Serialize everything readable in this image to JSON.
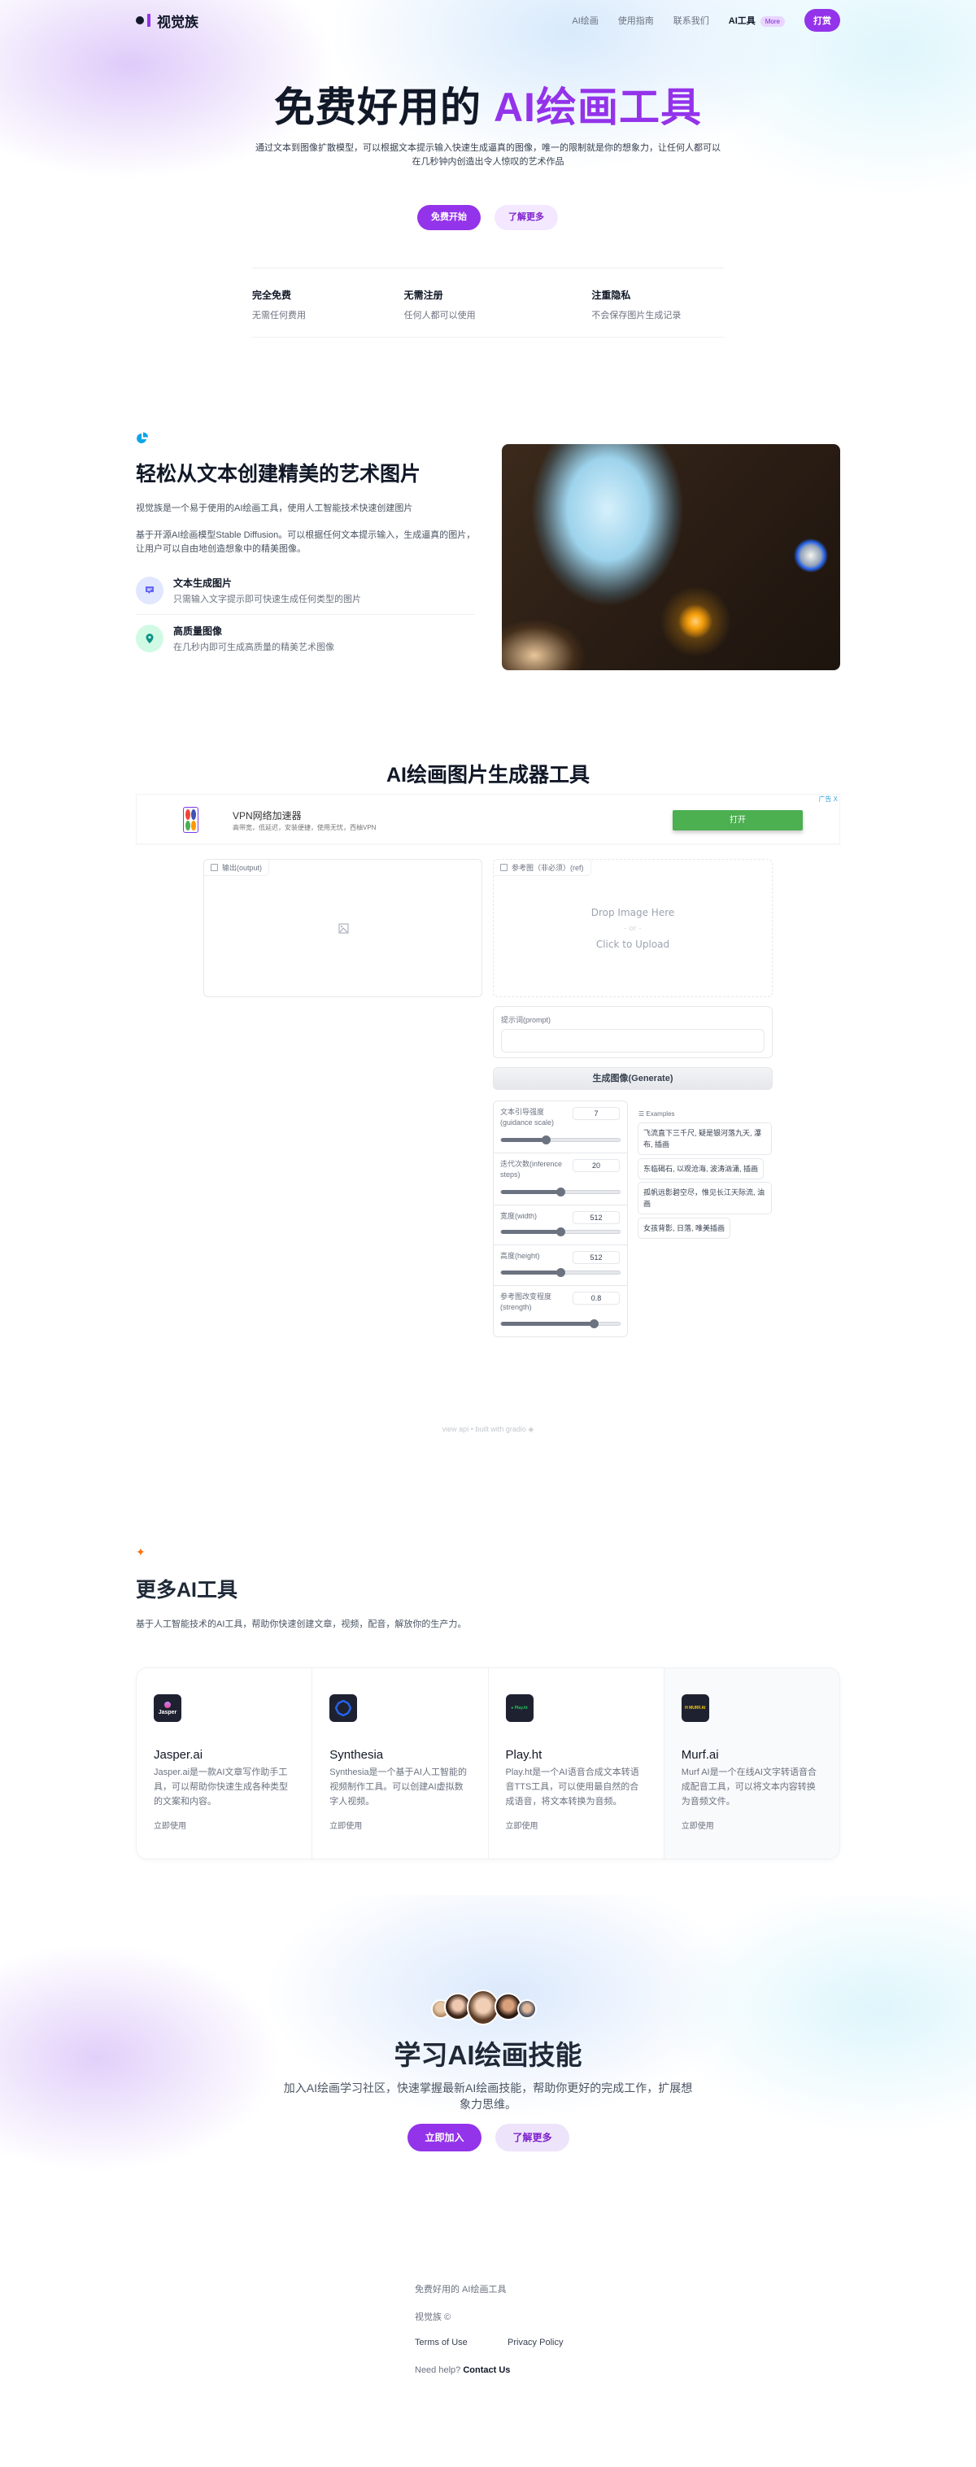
{
  "nav": {
    "brand": "视觉族",
    "links": [
      "AI绘画",
      "使用指南",
      "联系我们"
    ],
    "active_link": "AI工具",
    "more_badge": "More",
    "donate_label": "打赏"
  },
  "hero": {
    "title_plain": "免费好用的 ",
    "title_accent": "AI绘画工具",
    "subtitle": "通过文本到图像扩散模型，可以根据文本提示输入快速生成逼真的图像，唯一的限制就是你的想象力，让任何人都可以在几秒钟内创造出令人惊叹的艺术作品",
    "primary_button": "免费开始",
    "secondary_button": "了解更多",
    "features": [
      {
        "title": "完全免费",
        "desc": "无需任何费用"
      },
      {
        "title": "无需注册",
        "desc": "任何人都可以使用"
      },
      {
        "title": "注重隐私",
        "desc": "不会保存图片生成记录"
      }
    ]
  },
  "intro": {
    "title": "轻松从文本创建精美的艺术图片",
    "p1": "视觉族是一个易于使用的AI绘画工具，使用人工智能技术快速创建图片",
    "p2": "基于开源AI绘画模型Stable Diffusion。可以根据任何文本提示输入，生成逼真的图片，让用户可以自由地创造想象中的精美图像。",
    "items": [
      {
        "title": "文本生成图片",
        "desc": "只需输入文字提示即可快速生成任何类型的图片",
        "icon": "chat-icon"
      },
      {
        "title": "高质量图像",
        "desc": "在几秒内即可生成高质量的精美艺术图像",
        "icon": "location-pin-icon"
      }
    ]
  },
  "generator": {
    "title": "AI绘画图片生成器工具",
    "ad": {
      "title": "VPN网络加速器",
      "subtitle": "高带宽，低延迟，安装便捷，使用无忧，西柚VPN",
      "button": "打开",
      "label": "广告 X"
    },
    "output_label": "输出(output)",
    "ref_label": "参考图（非必须）(ref)",
    "upload_drop": "Drop Image Here",
    "upload_or": "- or -",
    "upload_click": "Click to Upload",
    "prompt_label": "提示词(prompt)",
    "prompt_value": "",
    "generate_button": "生成图像(Generate)",
    "sliders": [
      {
        "label": "文本引导强度(guidance scale)",
        "value": "7",
        "fraction": 0.38
      },
      {
        "label": "迭代次数(inference steps)",
        "value": "20",
        "fraction": 0.5
      },
      {
        "label": "宽度(width)",
        "value": "512",
        "fraction": 0.5
      },
      {
        "label": "高度(height)",
        "value": "512",
        "fraction": 0.5
      },
      {
        "label": "参考图改变程度(strength)",
        "value": "0.8",
        "fraction": 0.78
      }
    ],
    "examples_header": "☰ Examples",
    "examples": [
      "飞流直下三千尺, 疑是银河落九天, 瀑布, 插画",
      "东临碣石, 以观沧海, 波涛汹涌, 插画",
      "孤帆远影碧空尽，惟见长江天际流, 油画",
      "女孩背影, 日落, 唯美插画"
    ],
    "footer": "view api • built with gradio"
  },
  "tools": {
    "title": "更多AI工具",
    "subtitle": "基于人工智能技术的AI工具，帮助你快速创建文章，视频，配音，解放你的生产力。",
    "items": [
      {
        "name": "Jasper.ai",
        "icon_text": "Jasper",
        "desc": "Jasper.ai是一款AI文章写作助手工具，可以帮助你快速生成各种类型的文案和内容。",
        "link": "立即使用"
      },
      {
        "name": "Synthesia",
        "icon_text": "",
        "desc": "Synthesia是一个基于AI人工智能的视频制作工具。可以创建AI虚拟数字人视频。",
        "link": "立即使用"
      },
      {
        "name": "Play.ht",
        "icon_text": "● Play.ht",
        "desc": "Play.ht是一个AI语音合成文本转语音TTS工具，可以使用最自然的合成语音，将文本转换为音频。",
        "link": "立即使用"
      },
      {
        "name": "Murf.ai",
        "icon_text": "H MURF.AI",
        "desc": "Murf AI是一个在线AI文字转语音合成配音工具，可以将文本内容转换为音频文件。",
        "link": "立即使用"
      }
    ]
  },
  "cta": {
    "title": "学习AI绘画技能",
    "subtitle": "加入AI绘画学习社区，快速掌握最新AI绘画技能，帮助你更好的完成工作，扩展想象力思维。",
    "primary_button": "立即加入",
    "secondary_button": "了解更多"
  },
  "footer": {
    "tagline": "免费好用的 AI绘画工具",
    "copyright": "视觉族 ©",
    "terms": "Terms of Use",
    "privacy": "Privacy Policy",
    "help_prefix": "Need help?",
    "contact": "Contact Us"
  },
  "colors": {
    "accent": "#9333ea",
    "ad_button": "#4caf50"
  }
}
